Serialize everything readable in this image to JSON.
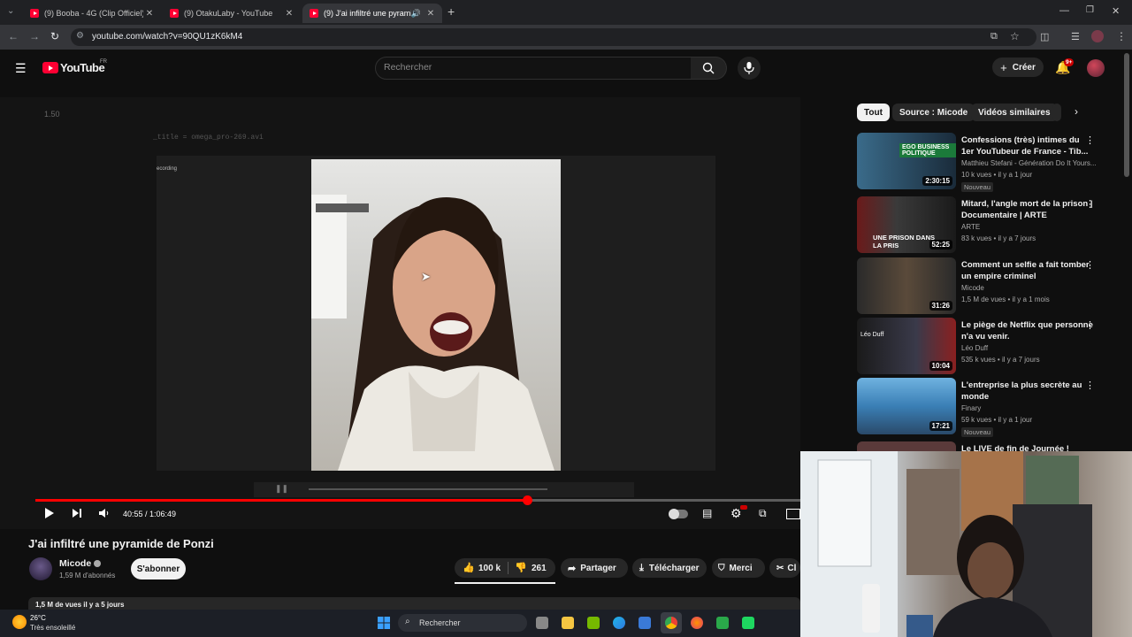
{
  "browser": {
    "tabs": [
      {
        "label": "(9) Booba - 4G (Clip Officiel) - Y",
        "active": false
      },
      {
        "label": "(9) OtakuLaby - YouTube",
        "active": false
      },
      {
        "label": "(9) J'ai infiltré une pyramide",
        "active": true
      }
    ],
    "url": "youtube.com/watch?v=90QU1zK6kM4",
    "new_tab_glyph": "+"
  },
  "header": {
    "logo_text": "YouTube",
    "logo_region": "FR",
    "search_placeholder": "Rechercher",
    "create_label": "Créer",
    "notif_badge": "9+"
  },
  "player": {
    "overlay_time": "1.50",
    "overlay_title": "_title = omega_pro-269.avi",
    "overlay_recording": "ecording",
    "current_time": "40:55 / 1:06:49",
    "progress": 0.6433,
    "colors": {
      "progress": "#ff0000",
      "accent": "#ff0033"
    }
  },
  "video": {
    "title": "J'ai infiltré une pyramide de Ponzi",
    "channel": "Micode",
    "subscribers": "1,59 M d'abonnés",
    "subscribe_label": "S'abonner",
    "likes": "100 k",
    "dislikes": "261",
    "share_label": "Partager",
    "download_label": "Télécharger",
    "thanks_label": "Merci",
    "clip_label": "Cl",
    "views_meta": "1,5 M de vues  il y a 5 jours"
  },
  "sidebar": {
    "chips": [
      "Tout",
      "Source : Micode",
      "Vidéos similaires"
    ],
    "items": [
      {
        "title": "Confessions (très) intimes du 1er YouTubeur de France - Tib...",
        "channel": "Matthieu Stefani - Génération Do It Yours...",
        "meta": "10 k vues • il y a 1 jour",
        "badge": "Nouveau",
        "duration": "2:30:15",
        "thumb_text": "EGO BUSINESS POLITIQUE"
      },
      {
        "title": "Mitard, l'angle mort de la prison | Documentaire | ARTE",
        "channel": "ARTE",
        "meta": "83 k vues • il y a 7 jours",
        "badge": "",
        "duration": "52:25",
        "thumb_text": "UNE PRISON DANS LA PRIS"
      },
      {
        "title": "Comment un selfie a fait tomber un empire criminel",
        "channel": "Micode",
        "meta": "1,5 M de vues • il y a 1 mois",
        "badge": "",
        "duration": "31:26",
        "thumb_text": ""
      },
      {
        "title": "Le piège de Netflix que personne n'a vu venir.",
        "channel": "Léo Duff",
        "meta": "535 k vues • il y a 7 jours",
        "badge": "",
        "duration": "10:04",
        "thumb_text": "Léo Duff"
      },
      {
        "title": "L'entreprise la plus secrète au monde",
        "channel": "Finary",
        "meta": "59 k vues • il y a 1 jour",
        "badge": "Nouveau",
        "duration": "17:21",
        "thumb_text": ""
      },
      {
        "title": "Le LIVE de fin de Journée !",
        "channel": "",
        "meta": "",
        "badge": "",
        "duration": "",
        "thumb_text": ""
      }
    ]
  },
  "taskbar": {
    "weather_temp": "26°C",
    "weather_desc": "Très ensoleillé",
    "search_label": "Rechercher"
  }
}
